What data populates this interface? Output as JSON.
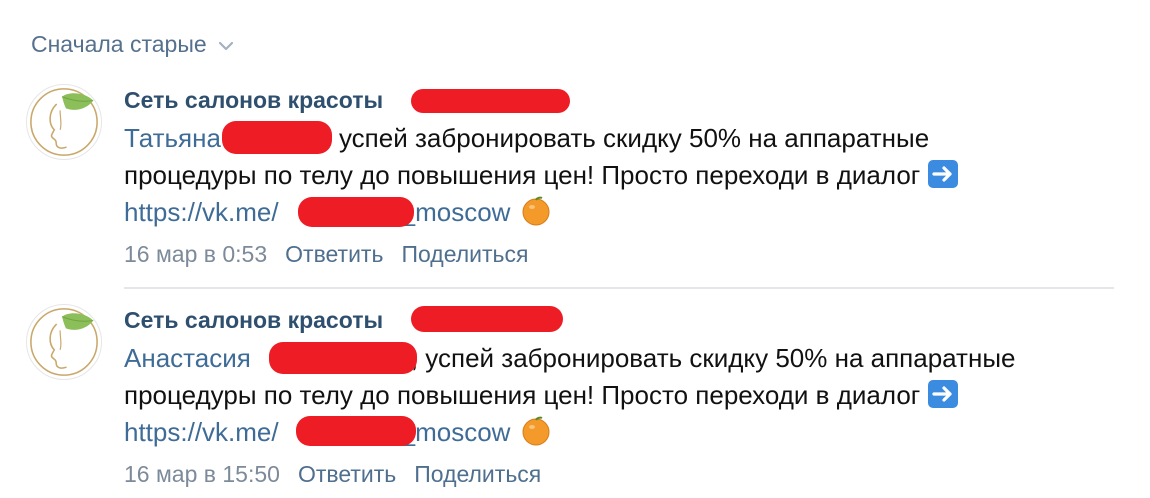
{
  "sort": {
    "label": "Сначала старые",
    "icon": "chevron-down-icon"
  },
  "comments": [
    {
      "author": "Сеть салонов красоты",
      "mention": "Татьяна",
      "text_line1": "успей забронировать скидку 50% на аппаратные",
      "text_line2": "процедуры по телу до повышения цен! Просто переходи в диалог",
      "link_prefix": "https://vk.me/",
      "link_suffix": "_moscow",
      "date": "16 мар в 0:53",
      "reply_label": "Ответить",
      "share_label": "Поделиться"
    },
    {
      "author": "Сеть салонов красоты",
      "mention": "Анастасия",
      "text_line1": ", успей забронировать скидку 50% на аппаратные",
      "text_line2": "процедуры по телу до повышения цен! Просто переходи в диалог",
      "link_prefix": "https://vk.me/",
      "link_suffix": "_moscow",
      "date": "16 мар в 15:50",
      "reply_label": "Ответить",
      "share_label": "Поделиться"
    }
  ],
  "colors": {
    "link": "#3f6c97",
    "author": "#2f4f6f",
    "meta": "#7c8a99",
    "redaction": "#ee1c25"
  },
  "icons": {
    "avatar": "salon-logo-face-leaf-icon",
    "arrow_emoji": "right-arrow-emoji-icon",
    "orange_emoji": "orange-emoji-icon"
  }
}
